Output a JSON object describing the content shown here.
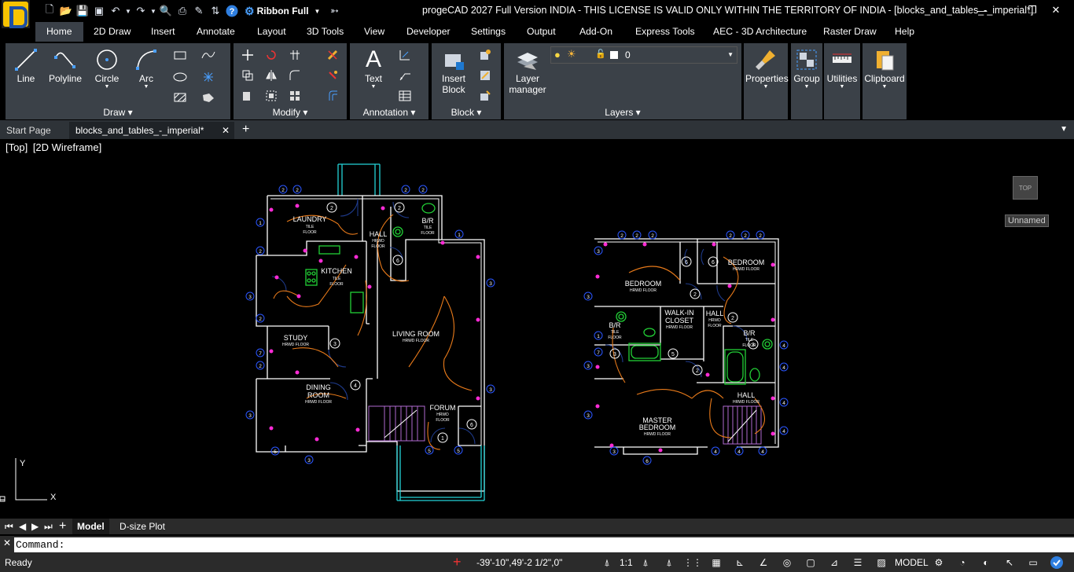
{
  "window": {
    "title": "progeCAD 2027 Full Version INDIA - THIS LICENSE IS VALID ONLY WITHIN THE TERRITORY OF INDIA - [blocks_and_tables_-_imperial*]",
    "ribbon_mode": "Ribbon Full"
  },
  "menu_tabs": [
    "Home",
    "2D Draw",
    "Insert",
    "Annotate",
    "Layout",
    "3D Tools",
    "View",
    "Developer",
    "Settings",
    "Output",
    "Add-On",
    "Express Tools",
    "AEC - 3D Architecture",
    "Raster Draw",
    "Help"
  ],
  "ribbon": {
    "draw": {
      "label": "Draw",
      "line": "Line",
      "polyline": "Polyline",
      "circle": "Circle",
      "arc": "Arc"
    },
    "modify": {
      "label": "Modify"
    },
    "annotation": {
      "label": "Annotation",
      "text": "Text"
    },
    "block": {
      "label": "Block",
      "insert_line1": "Insert",
      "insert_line2": "Block"
    },
    "layers": {
      "label": "Layers",
      "manager_line1": "Layer",
      "manager_line2": "manager",
      "current_layer": "0"
    },
    "properties": "Properties",
    "group": "Group",
    "utilities": "Utilities",
    "clipboard": "Clipboard"
  },
  "doc_tabs": {
    "start": "Start Page",
    "current": "blocks_and_tables_-_imperial*",
    "add": "+"
  },
  "viewport": {
    "view_label": "[Top]",
    "style_label": "[2D Wireframe]",
    "viewcube_label": "TOP",
    "named_view": "Unnamed",
    "ucs_x": "X",
    "ucs_y": "Y"
  },
  "rooms": {
    "laundry": "LAUNDRY",
    "tile_floor": "TILE",
    "floor": "FLOOR",
    "br": "B/R",
    "hall": "HALL",
    "kitchen": "KITCHEN",
    "living_room": "LIVING ROOM",
    "hrwd_floor": "HRWD FLOOR",
    "study": "STUDY",
    "dining": "DINING",
    "room": "ROOM",
    "forum": "FORUM",
    "hrwd": "HRWD",
    "bedroom": "BEDROOM",
    "walk_in": "WALK-IN",
    "closet": "CLOSET",
    "master": "MASTER"
  },
  "layout_tabs": {
    "model": "Model",
    "plot": "D-size Plot"
  },
  "command": {
    "prompt": "Command:"
  },
  "status": {
    "ready": "Ready",
    "coords": "-39'-10\",49'-2 1/2\",0\"",
    "scale": "1:1",
    "model": "MODEL"
  },
  "colors": {
    "panel": "#3b4148",
    "wall": "#ffffff",
    "door": "#1e3a8a",
    "wire": "#e87a1a",
    "outlet": "#ff2bd6",
    "stair": "#b06ad0",
    "fixture": "#22d036",
    "porch": "#24d3d8",
    "dim": "#2a56ff"
  }
}
